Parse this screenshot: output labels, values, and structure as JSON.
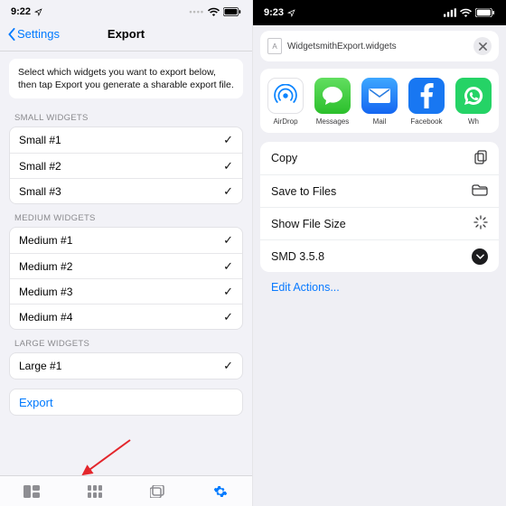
{
  "left": {
    "status": {
      "time": "9:22"
    },
    "nav": {
      "back": "Settings",
      "title": "Export"
    },
    "intro": "Select which widgets you want to export below, then tap Export you generate a sharable export file.",
    "sections": {
      "small": {
        "label": "SMALL WIDGETS",
        "items": [
          "Small #1",
          "Small #2",
          "Small #3"
        ]
      },
      "medium": {
        "label": "MEDIUM WIDGETS",
        "items": [
          "Medium #1",
          "Medium #2",
          "Medium #3",
          "Medium #4"
        ]
      },
      "large": {
        "label": "LARGE WIDGETS",
        "items": [
          "Large #1"
        ]
      }
    },
    "export_label": "Export"
  },
  "right": {
    "status": {
      "time": "9:23"
    },
    "filename": "WidgetsmithExport.widgets",
    "apps": [
      {
        "name": "AirDrop",
        "cls": "airdrop"
      },
      {
        "name": "Messages",
        "cls": "messages"
      },
      {
        "name": "Mail",
        "cls": "mail"
      },
      {
        "name": "Facebook",
        "cls": "facebook"
      },
      {
        "name": "Wh",
        "cls": "whatsapp"
      }
    ],
    "actions": [
      {
        "label": "Copy",
        "icon": "copy"
      },
      {
        "label": "Save to Files",
        "icon": "folder"
      },
      {
        "label": "Show File Size",
        "icon": "sparkle"
      },
      {
        "label": "SMD 3.5.8",
        "icon": "chevdown"
      }
    ],
    "edit_actions": "Edit Actions..."
  }
}
